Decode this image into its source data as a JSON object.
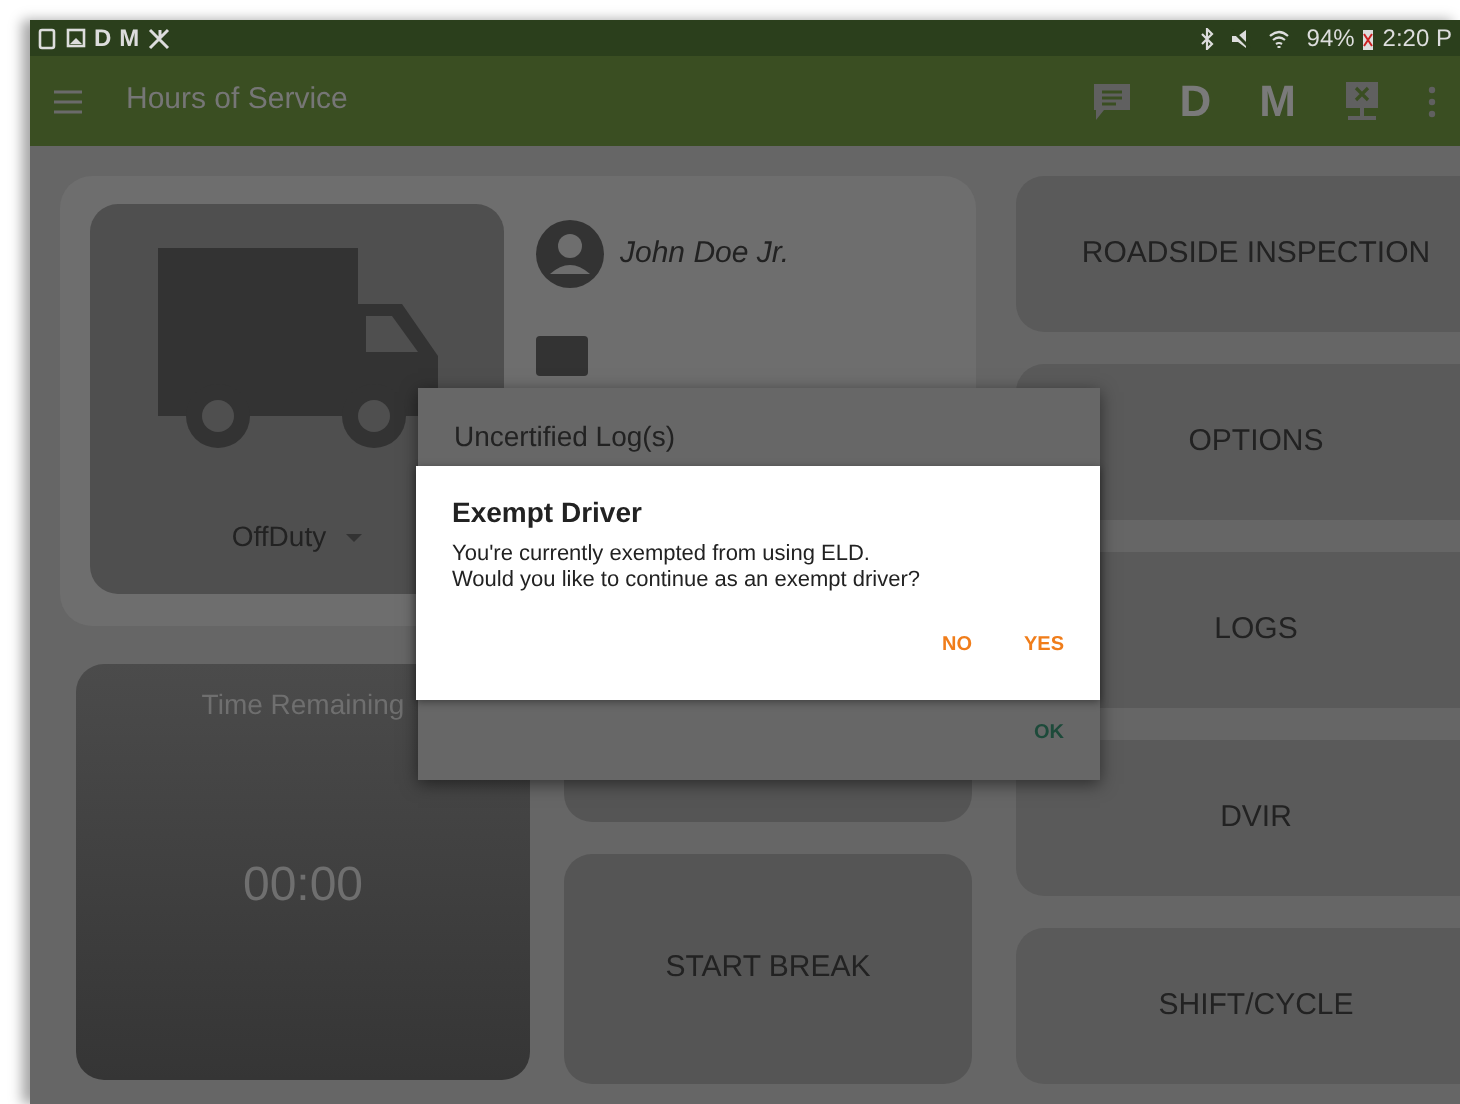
{
  "status_bar": {
    "left_letters": [
      "D",
      "M"
    ],
    "battery": "94%",
    "time": "2:20 P"
  },
  "app_bar": {
    "title": "Hours of Service",
    "action_letters": [
      "D",
      "M"
    ]
  },
  "driver_card": {
    "status": "OffDuty",
    "driver_name": "John Doe Jr."
  },
  "timer": {
    "label": "Time Remaining",
    "value": "00:00"
  },
  "middle_buttons": [
    "START BREAK"
  ],
  "side_buttons": [
    "ROADSIDE INSPECTION",
    "OPTIONS",
    "LOGS",
    "DVIR",
    "SHIFT/CYCLE"
  ],
  "uncertified_dialog": {
    "title": "Uncertified Log(s)",
    "button": "OK"
  },
  "exempt_dialog": {
    "title": "Exempt Driver",
    "message": "You're currently exempted from using ELD.\nWould you like to continue as an exempt driver?",
    "buttons": [
      "NO",
      "YES"
    ]
  }
}
